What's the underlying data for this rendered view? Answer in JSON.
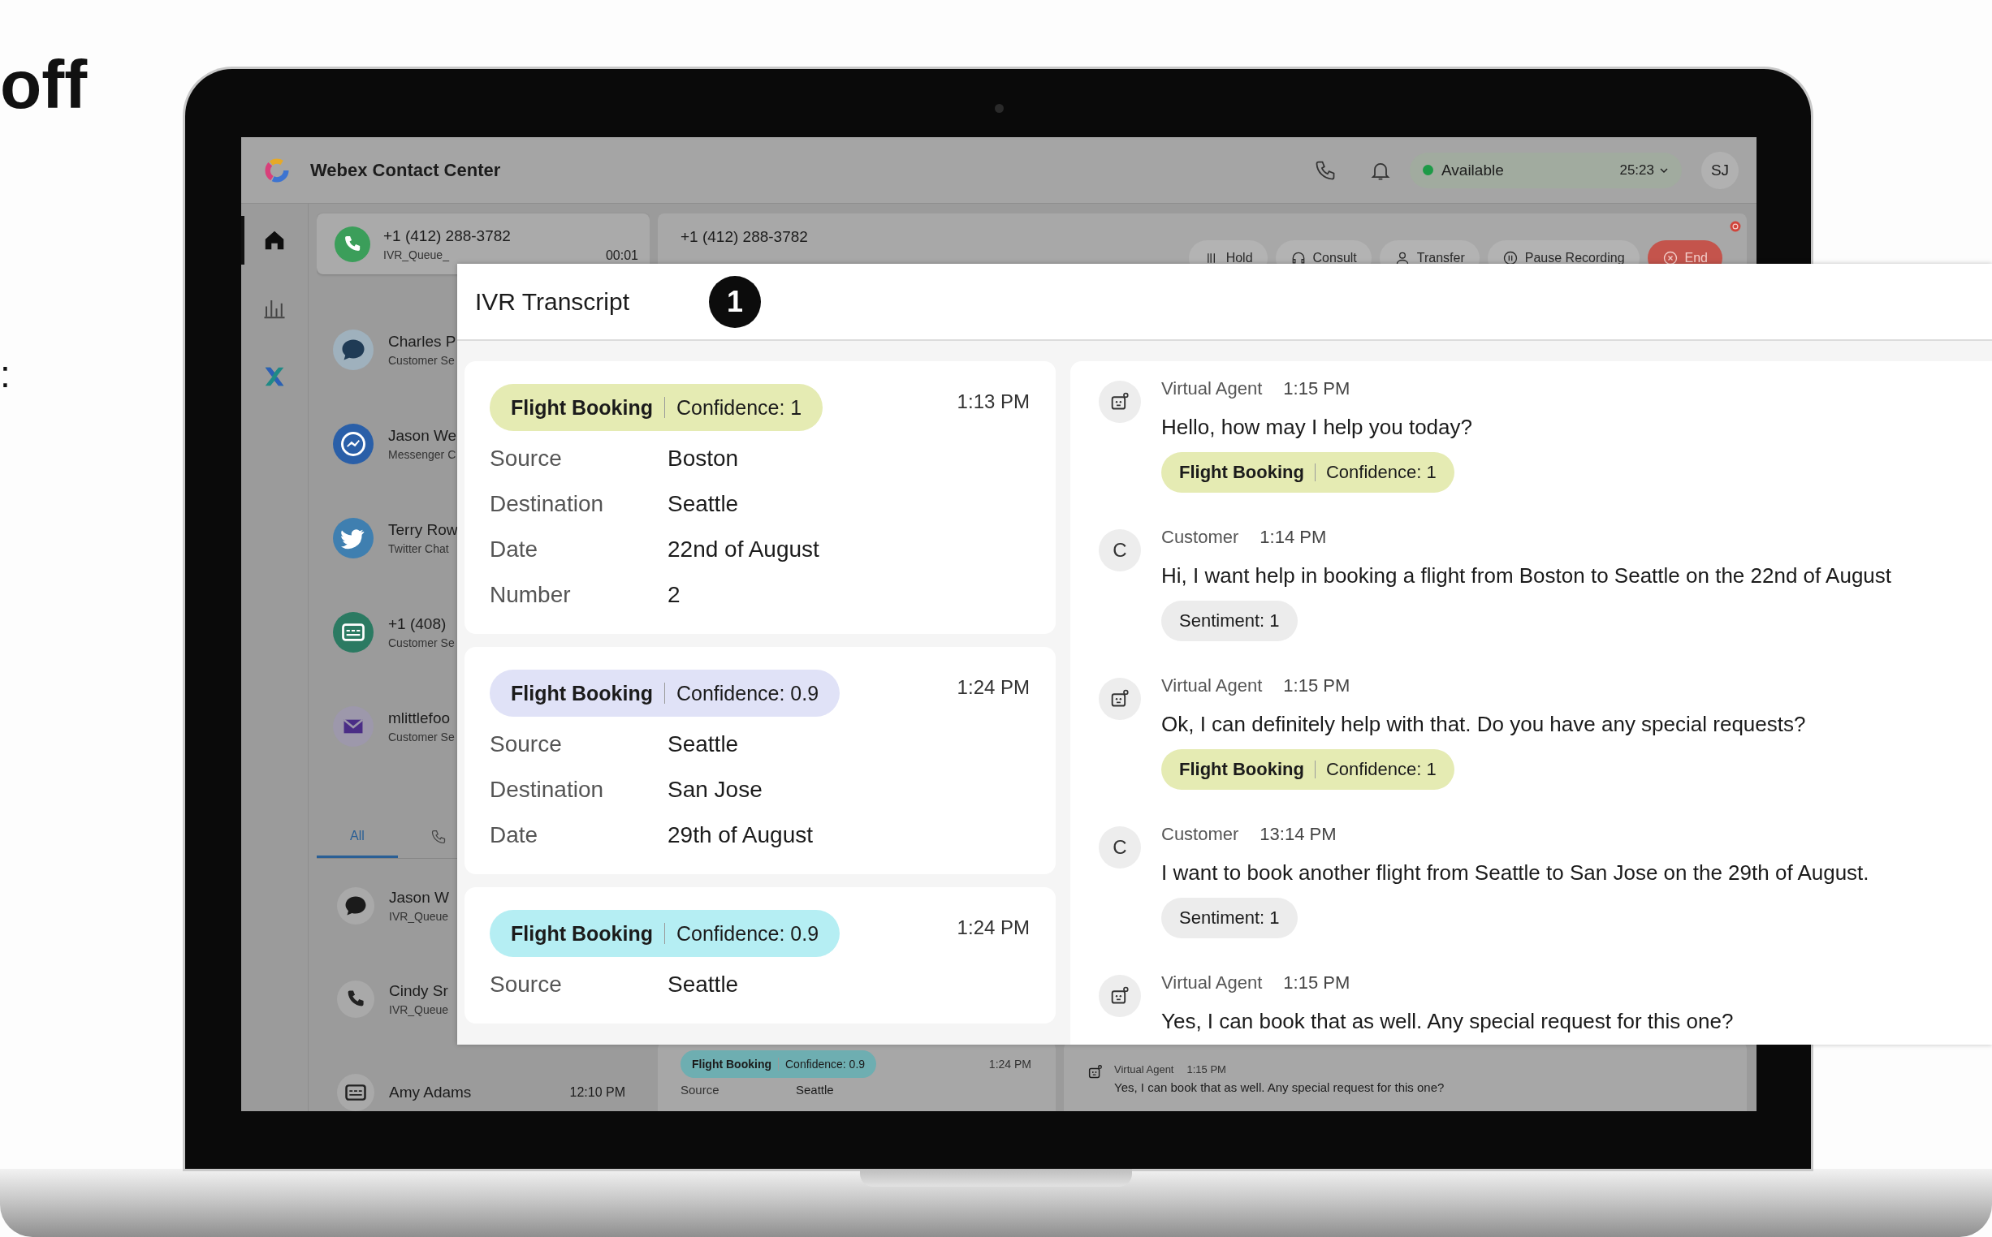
{
  "promo": {
    "heading": "off",
    "fragment": ":"
  },
  "app": {
    "title": "Webex Contact Center",
    "status": "Available",
    "timer": "25:23",
    "avatar": "SJ",
    "nav": [
      {
        "kind": "home",
        "selected": true
      },
      {
        "kind": "analytics",
        "selected": false
      },
      {
        "kind": "apps",
        "selected": false
      }
    ],
    "active_call": {
      "number": "+1 (412) 288-3782",
      "queue": "IVR_Queue_",
      "duration": "00:01"
    },
    "contacts": [
      {
        "kind": "chat",
        "name": "Charles P",
        "subtitle": "Customer Se"
      },
      {
        "kind": "messenger",
        "name": "Jason We",
        "subtitle": "Messenger C"
      },
      {
        "kind": "twitter",
        "name": "Terry Row",
        "subtitle": "Twitter Chat"
      },
      {
        "kind": "sms",
        "name": "+1 (408)",
        "subtitle": "Customer Se"
      },
      {
        "kind": "email",
        "name": "mlittlefoo",
        "subtitle": "Customer Se"
      }
    ],
    "history_tabs": [
      {
        "kind": "text",
        "label": "All",
        "selected": true
      },
      {
        "kind": "phone",
        "selected": false
      }
    ],
    "history": [
      {
        "kind": "chat",
        "name": "Jason W",
        "subtitle": "IVR_Queue"
      },
      {
        "kind": "phone",
        "name": "Cindy Sr",
        "subtitle": "IVR_Queue"
      },
      {
        "kind": "sms",
        "name": "Amy Adams",
        "time": "12:10 PM"
      }
    ],
    "call": {
      "number": "+1 (412) 288-3782",
      "actions": [
        {
          "kind": "hold",
          "label": "Hold"
        },
        {
          "kind": "consult",
          "label": "Consult"
        },
        {
          "kind": "transfer",
          "label": "Transfer"
        },
        {
          "kind": "pause_recording",
          "label": "Pause Recording"
        },
        {
          "kind": "end",
          "label": "End"
        }
      ]
    },
    "background_intent": {
      "intent": "Flight Booking",
      "confidence": "Confidence: 0.9",
      "color": "#6eaeb1",
      "time": "1:24 PM",
      "fields": [
        {
          "label": "Source",
          "value": "Seattle"
        }
      ]
    },
    "background_message": {
      "speaker": "Virtual Agent",
      "time": "1:15 PM",
      "text": "Yes, I can book that as well. Any special request for this one?"
    }
  },
  "ivr_transcript": {
    "title": "IVR Transcript",
    "step": "1",
    "intents": [
      {
        "intent": "Flight Booking",
        "confidence": "Confidence: 1",
        "color": "#e5ebb3",
        "time": "1:13 PM",
        "fields": [
          {
            "label": "Source",
            "value": "Boston"
          },
          {
            "label": "Destination",
            "value": "Seattle"
          },
          {
            "label": "Date",
            "value": "22nd of August"
          },
          {
            "label": "Number",
            "value": "2"
          }
        ]
      },
      {
        "intent": "Flight Booking",
        "confidence": "Confidence: 0.9",
        "color": "#e0e2f7",
        "time": "1:24 PM",
        "fields": [
          {
            "label": "Source",
            "value": "Seattle"
          },
          {
            "label": "Destination",
            "value": "San Jose"
          },
          {
            "label": "Date",
            "value": "29th of August"
          }
        ]
      },
      {
        "intent": "Flight Booking",
        "confidence": "Confidence: 0.9",
        "color": "#b5eef3",
        "time": "1:24 PM",
        "fields": [
          {
            "label": "Source",
            "value": "Seattle"
          }
        ]
      }
    ],
    "messages": [
      {
        "kind": "virtual_agent",
        "speaker": "Virtual Agent",
        "time": "1:15 PM",
        "text": "Hello, how may I help you today?",
        "chip": {
          "kind": "intent",
          "intent": "Flight Booking",
          "confidence": "Confidence: 1",
          "color": "#e5ebb3"
        }
      },
      {
        "kind": "customer",
        "avatar": "C",
        "speaker": "Customer",
        "time": "1:14 PM",
        "text": "Hi, I want help in booking a flight from Boston to Seattle on the 22nd of August",
        "chip": {
          "kind": "sentiment",
          "label": "Sentiment: 1"
        }
      },
      {
        "kind": "virtual_agent",
        "speaker": "Virtual Agent",
        "time": "1:15 PM",
        "text": "Ok, I can definitely help with that. Do you have any special requests?",
        "chip": {
          "kind": "intent",
          "intent": "Flight Booking",
          "confidence": "Confidence: 1",
          "color": "#e5ebb3"
        }
      },
      {
        "kind": "customer",
        "avatar": "C",
        "speaker": "Customer",
        "time": "13:14 PM",
        "text": "I want to book another flight from Seattle to San Jose on the 29th of August.",
        "chip": {
          "kind": "sentiment",
          "label": "Sentiment: 1"
        }
      },
      {
        "kind": "virtual_agent",
        "speaker": "Virtual Agent",
        "time": "1:15 PM",
        "text": "Yes, I can book that as well. Any special request for this one?"
      }
    ]
  }
}
